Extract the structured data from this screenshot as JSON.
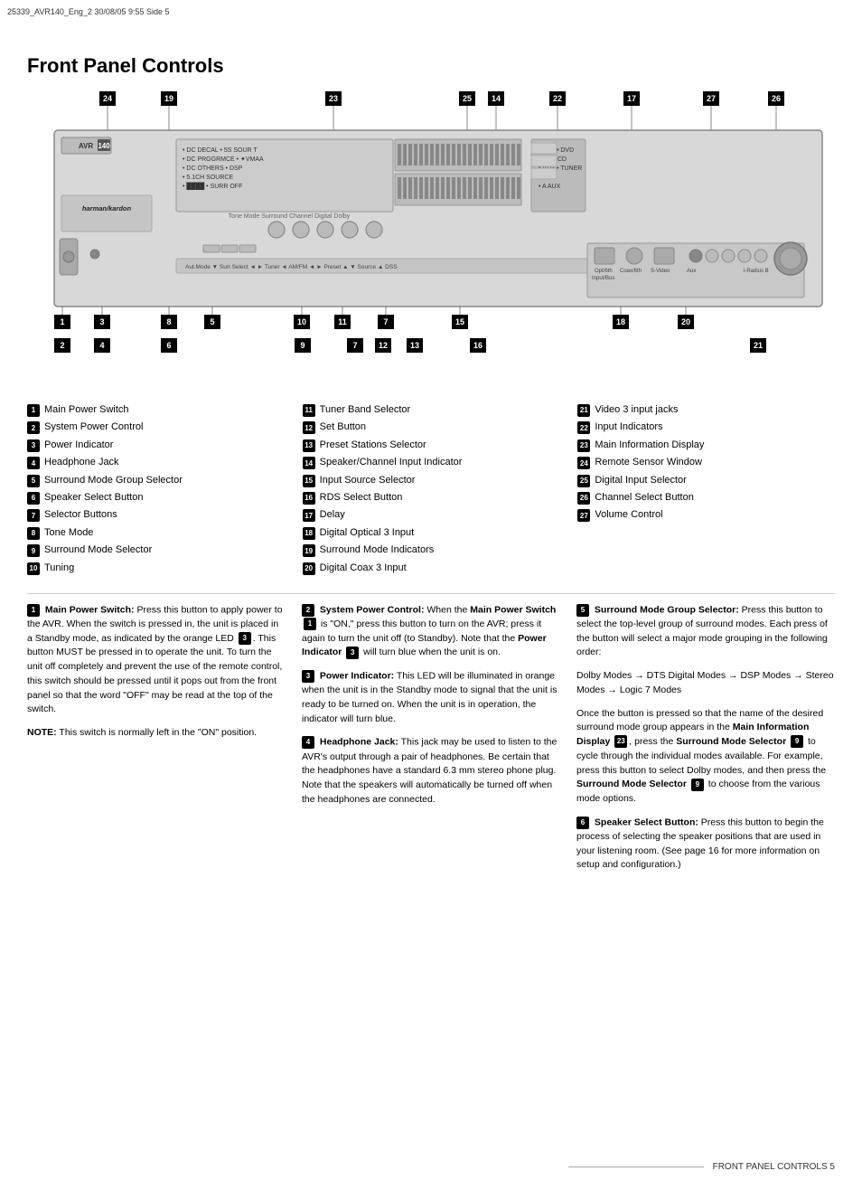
{
  "corner_text": "25339_AVR140_Eng_2  30/08/05  9:55  Side 5",
  "page_title": "Front Panel Controls",
  "diagram": {
    "top_numbers": [
      "24",
      "19",
      "23",
      "25",
      "14",
      "22",
      "17",
      "27",
      "26"
    ],
    "bottom_numbers": [
      "1",
      "2",
      "3",
      "4",
      "8",
      "5",
      "6",
      "9",
      "7",
      "10",
      "11",
      "12",
      "13",
      "7",
      "15",
      "16",
      "18",
      "20",
      "21"
    ]
  },
  "items_col1": [
    {
      "num": "1",
      "label": "Main Power Switch"
    },
    {
      "num": "2",
      "label": "System Power Control"
    },
    {
      "num": "3",
      "label": "Power Indicator"
    },
    {
      "num": "4",
      "label": "Headphone Jack"
    },
    {
      "num": "5",
      "label": "Surround Mode Group Selector"
    },
    {
      "num": "6",
      "label": "Speaker Select Button"
    },
    {
      "num": "7",
      "label": "Selector Buttons"
    },
    {
      "num": "8",
      "label": "Tone Mode"
    },
    {
      "num": "9",
      "label": "Surround Mode Selector"
    },
    {
      "num": "10",
      "label": "Tuning"
    }
  ],
  "items_col2": [
    {
      "num": "11",
      "label": "Tuner Band Selector"
    },
    {
      "num": "12",
      "label": "Set Button"
    },
    {
      "num": "13",
      "label": "Preset Stations Selector"
    },
    {
      "num": "14",
      "label": "Speaker/Channel Input Indicator"
    },
    {
      "num": "15",
      "label": "Input Source Selector"
    },
    {
      "num": "16",
      "label": "RDS Select Button"
    },
    {
      "num": "17",
      "label": "Delay"
    },
    {
      "num": "18",
      "label": "Digital Optical 3 Input"
    },
    {
      "num": "19",
      "label": "Surround Mode Indicators"
    },
    {
      "num": "20",
      "label": "Digital Coax 3 Input"
    }
  ],
  "items_col3": [
    {
      "num": "21",
      "label": "Video 3 input jacks"
    },
    {
      "num": "22",
      "label": "Input Indicators"
    },
    {
      "num": "23",
      "label": "Main Information Display"
    },
    {
      "num": "24",
      "label": "Remote Sensor Window"
    },
    {
      "num": "25",
      "label": "Digital Input Selector"
    },
    {
      "num": "26",
      "label": "Channel Select Button"
    },
    {
      "num": "27",
      "label": "Volume Control"
    }
  ],
  "descriptions": [
    {
      "num": "1",
      "title": "Main Power Switch:",
      "body": "Press this button to apply power to the AVR. When the switch is pressed in, the unit is placed in a Standby mode, as indicated by the orange LED ",
      "ref1": "3",
      "body2": ". This button MUST be pressed in to operate the unit. To turn the unit off completely and prevent the use of the remote control, this switch should be pressed until it pops out from the front panel so that the word \"OFF\" may be read at the top of the switch.",
      "note_label": "NOTE:",
      "note_body": "This switch is normally left in the \"ON\" position."
    },
    {
      "num": "2",
      "title": "System Power Control:",
      "body": "When the ",
      "bold1": "Main Power Switch ",
      "ref1": "1",
      "body2": " is \"ON,\" press this button to turn on the AVR; press it again to turn the unit off (to Standby). Note that the ",
      "bold2": "Power Indicator ",
      "ref2": "3",
      "body3": " will turn blue when the unit is on."
    },
    {
      "num": "3",
      "title": "Power Indicator:",
      "body": "This LED will be illuminated in orange when the unit is in the Standby mode to signal that the unit is ready to be turned on. When the unit is in operation, the indicator will turn blue."
    },
    {
      "num": "4",
      "title": "Headphone Jack:",
      "body": "This jack may be used to listen to the AVR's output through a pair of headphones. Be certain that the headphones have a standard 6.3 mm stereo phone plug. Note that the speakers will automatically be turned off when the headphones are connected."
    },
    {
      "num": "5",
      "title": "Surround Mode Group Selector:",
      "body": "Press this button to select the top-level group of surround modes. Each press of the button will select a major mode grouping in the following order:",
      "modes": "Dolby Modes → DTS Digital Modes → DSP Modes → Stereo Modes → Logic 7 Modes",
      "body2": "Once the button is pressed so that the name of the desired surround mode group appears in the ",
      "bold1": "Main Information Display ",
      "ref1": "23",
      "body3": ", press the ",
      "bold2": "Surround Mode Selector ",
      "ref2": "9",
      "body4": " to cycle through the individual modes available. For example, press this button to select Dolby modes, and then press the ",
      "bold3": "Surround Mode Selector ",
      "ref3": "9",
      "body5": " to choose from the various mode options."
    },
    {
      "num": "6",
      "title": "Speaker Select Button:",
      "body": "Press this button to begin the process of selecting the speaker positions that are used in your listening room. (See page 16 for more information on setup and configuration.)"
    }
  ],
  "footer_text": "FRONT PANEL CONTROLS  5"
}
